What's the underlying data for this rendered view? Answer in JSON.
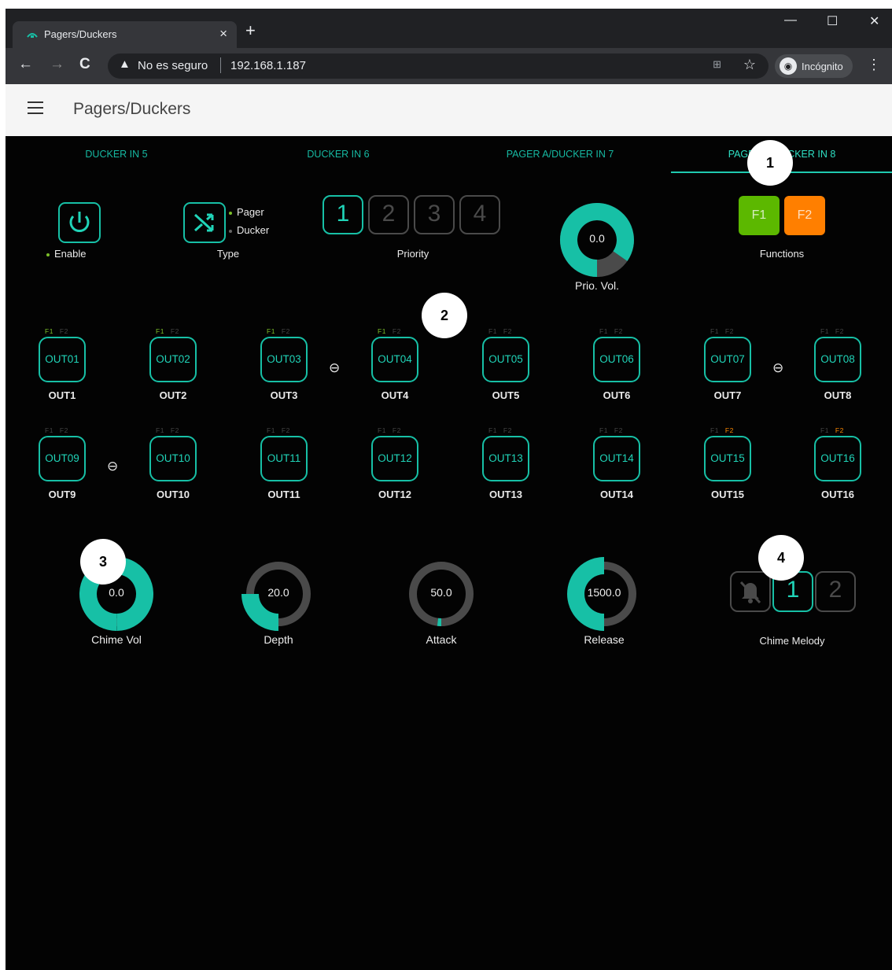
{
  "browser": {
    "tab_title": "Pagers/Duckers",
    "tab_close": "×",
    "new_tab": "+",
    "security_warning": "No es seguro",
    "url": "192.168.1.187",
    "incognito_label": "Incógnito",
    "window_controls": [
      "—",
      "☐",
      "✕"
    ]
  },
  "app": {
    "title": "Pagers/Duckers"
  },
  "tabs": [
    "DUCKER IN 5",
    "DUCKER IN 6",
    "PAGER A/DUCKER IN 7",
    "PAGER A/DUCKER IN 8"
  ],
  "active_tab": 3,
  "controls": {
    "enable_label": "Enable",
    "type_label": "Type",
    "type_options": [
      "Pager",
      "Ducker"
    ],
    "priority_label": "Priority",
    "priority_options": [
      "1",
      "2",
      "3",
      "4"
    ],
    "priority_selected": "1",
    "prio_vol_label": "Prio. Vol.",
    "prio_vol_value": "0.0",
    "functions_label": "Functions",
    "functions": [
      "F1",
      "F2"
    ]
  },
  "outputs": [
    {
      "btn": "OUT01",
      "name": "OUT1",
      "f1": true,
      "f2": false
    },
    {
      "btn": "OUT02",
      "name": "OUT2",
      "f1": true,
      "f2": false
    },
    {
      "btn": "OUT03",
      "name": "OUT3",
      "f1": true,
      "f2": false
    },
    {
      "btn": "OUT04",
      "name": "OUT4",
      "f1": true,
      "f2": false
    },
    {
      "btn": "OUT05",
      "name": "OUT5",
      "f1": false,
      "f2": false
    },
    {
      "btn": "OUT06",
      "name": "OUT6",
      "f1": false,
      "f2": false
    },
    {
      "btn": "OUT07",
      "name": "OUT7",
      "f1": false,
      "f2": false
    },
    {
      "btn": "OUT08",
      "name": "OUT8",
      "f1": false,
      "f2": false
    },
    {
      "btn": "OUT09",
      "name": "OUT9",
      "f1": false,
      "f2": false
    },
    {
      "btn": "OUT10",
      "name": "OUT10",
      "f1": false,
      "f2": false
    },
    {
      "btn": "OUT11",
      "name": "OUT11",
      "f1": false,
      "f2": false
    },
    {
      "btn": "OUT12",
      "name": "OUT12",
      "f1": false,
      "f2": false
    },
    {
      "btn": "OUT13",
      "name": "OUT13",
      "f1": false,
      "f2": false
    },
    {
      "btn": "OUT14",
      "name": "OUT14",
      "f1": false,
      "f2": false
    },
    {
      "btn": "OUT15",
      "name": "OUT15",
      "f1": false,
      "f2": true
    },
    {
      "btn": "OUT16",
      "name": "OUT16",
      "f1": false,
      "f2": true
    }
  ],
  "f_labels": [
    "F1",
    "F2"
  ],
  "knobs": [
    {
      "label": "Chime Vol",
      "value": "0.0",
      "fill": 1.0
    },
    {
      "label": "Depth",
      "value": "20.0",
      "fill": 0.25
    },
    {
      "label": "Attack",
      "value": "50.0",
      "fill": 0.02
    },
    {
      "label": "Release",
      "value": "1500.0",
      "fill": 0.5
    }
  ],
  "chime": {
    "label": "Chime Melody",
    "options": [
      "1",
      "2"
    ],
    "selected": "1"
  },
  "markers": [
    "1",
    "2",
    "3",
    "4"
  ],
  "colors": {
    "accent": "#17c0a6",
    "f1": "#5cb800",
    "f2": "#ff7f00",
    "knob_track": "#4a4a4a"
  }
}
